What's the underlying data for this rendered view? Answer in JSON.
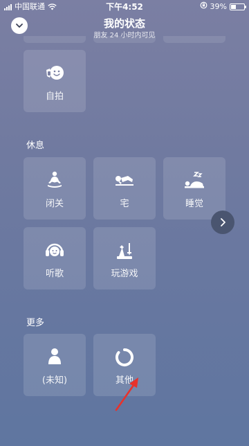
{
  "status_bar": {
    "carrier": "中国联通",
    "time": "下午4:52",
    "battery_percent": "39%",
    "battery_level": 0.39
  },
  "header": {
    "title": "我的状态",
    "subtitle": "朋友 24 小时内可见",
    "collapse_icon": "chevron-down-icon"
  },
  "sections": {
    "selfie_row": {
      "items": [
        {
          "label": "自拍",
          "icon": "selfie-face-icon"
        }
      ]
    },
    "rest": {
      "title": "休息",
      "items": [
        {
          "label": "闭关",
          "icon": "meditation-icon"
        },
        {
          "label": "宅",
          "icon": "lying-down-icon"
        },
        {
          "label": "睡觉",
          "icon": "sleep-icon"
        },
        {
          "label": "听歌",
          "icon": "headphones-icon"
        },
        {
          "label": "玩游戏",
          "icon": "game-pieces-icon"
        }
      ]
    },
    "more": {
      "title": "更多",
      "items": [
        {
          "label": "(未知)",
          "icon": "person-icon"
        },
        {
          "label": "其他",
          "icon": "ring-icon"
        }
      ]
    }
  },
  "colors": {
    "annotation_arrow": "#e8322b",
    "next_button_bg": "#4a5570"
  },
  "next_button_icon": "chevron-right-icon"
}
